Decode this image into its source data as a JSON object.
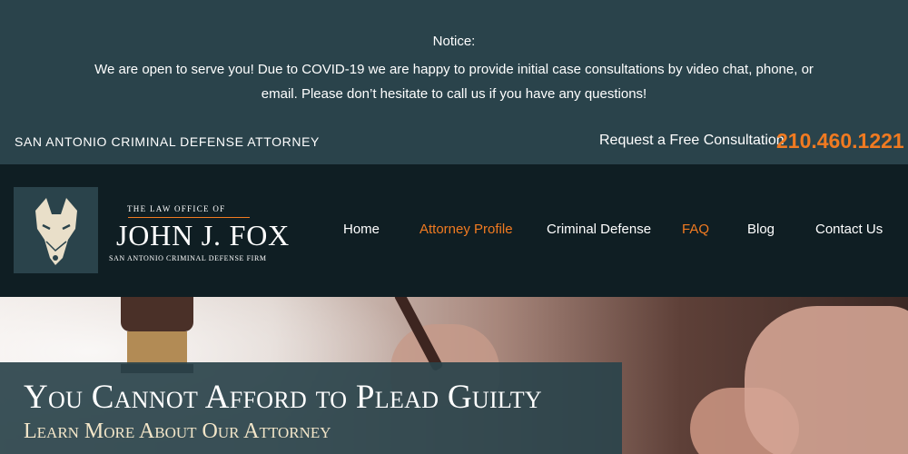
{
  "notice": {
    "title": "Notice:",
    "body": "We are open to serve you! Due to COVID-19 we are happy to provide initial case consultations by video chat, phone, or email. Please don’t hesitate to call us if you have any questions!"
  },
  "top_strip": {
    "tagline": "SAN ANTONIO CRIMINAL DEFENSE ATTORNEY",
    "consult_label": "Request a Free Consultation",
    "phone": "210.460.1221"
  },
  "logo": {
    "small_line": "THE LAW OFFICE OF",
    "name": "JOHN J. FOX",
    "sub_line": "SAN ANTONIO CRIMINAL DEFENSE FIRM",
    "icon": "fox-head-icon"
  },
  "nav": {
    "items": [
      {
        "label": "Home",
        "active": false
      },
      {
        "label": "Attorney Profile",
        "active": true
      },
      {
        "label": "Criminal Defense",
        "active": false
      },
      {
        "label": "FAQ",
        "active": true
      },
      {
        "label": "Blog",
        "active": false
      },
      {
        "label": "Contact Us",
        "active": false
      }
    ]
  },
  "hero": {
    "title": "You Cannot Afford to Plead Guilty",
    "link": "Learn More About Our Attorney"
  },
  "colors": {
    "header_bg": "#2a434b",
    "nav_bg": "#0f1e23",
    "accent": "#f07a21"
  }
}
